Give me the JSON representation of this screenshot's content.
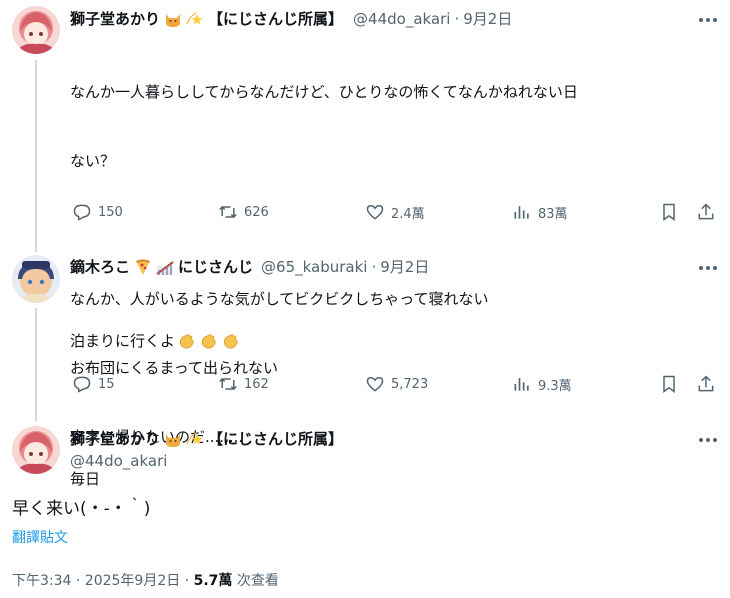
{
  "tweet1": {
    "name": "獅子堂あかり",
    "tag": "【にじさんじ所属】",
    "handle": "@44do_akari",
    "dot": "·",
    "date": "9月2日",
    "lines": [
      "なんか一人暮らししてからなんだけど、ひとりなの怖くてなんかねれない日",
      "ない？",
      "",
      "なんか、人がいるような気がしてビクビクしちゃって寝れない",
      "お布団にくるまって出られない",
      "実家に帰りたいのだ........"
    ],
    "replies": "150",
    "retweets": "626",
    "likes": "2.4萬",
    "views": "83萬"
  },
  "tweet2": {
    "name": "鏑木ろこ",
    "tag": "にじさんじ",
    "handle": "@65_kaburaki",
    "dot": "·",
    "date": "9月2日",
    "line1": "泊まりに行くよ",
    "line2": "毎日",
    "replies": "15",
    "retweets": "162",
    "likes": "5,723",
    "views": "9.3萬"
  },
  "main": {
    "name": "獅子堂あかり",
    "tag": "【にじさんじ所属】",
    "handle": "@44do_akari",
    "text": "早く来い(・-・｀)",
    "translate": "翻譯貼文",
    "time": "下午3:34 · 2025年9月2日 · ",
    "views": "5.7萬",
    "views_label": " 次查看"
  },
  "icons": {
    "reply": "reply-icon",
    "retweet": "retweet-icon",
    "like": "heart-icon",
    "views": "views-icon",
    "bookmark": "bookmark-icon",
    "share": "share-icon",
    "more": "more-icon"
  },
  "colors": {
    "text": "#0f1419",
    "secondary": "#536471",
    "link": "#1d9bf0",
    "line": "#cfd9de"
  }
}
